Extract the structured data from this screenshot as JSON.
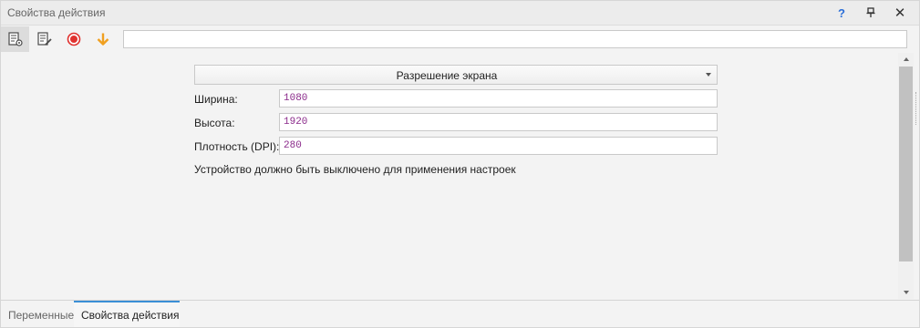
{
  "window": {
    "title": "Свойства действия",
    "help_glyph": "?",
    "close_glyph": "✕"
  },
  "toolbar": {
    "tools": [
      {
        "icon": "properties-list-icon",
        "active": true
      },
      {
        "icon": "edit-notes-icon",
        "active": false
      },
      {
        "icon": "record-icon",
        "color": "#e0322f",
        "active": false
      },
      {
        "icon": "arrow-down-icon",
        "color": "#f0a020",
        "active": false
      }
    ],
    "input_value": ""
  },
  "form": {
    "dropdown_value": "Разрешение экрана",
    "width_label": "Ширина:",
    "width_value": "1080",
    "height_label": "Высота:",
    "height_value": "1920",
    "dpi_label": "Плотность (DPI):",
    "dpi_value": "280",
    "note": "Устройство должно быть выключено для применения настроек"
  },
  "tabs": {
    "items": [
      {
        "label": "Переменные",
        "active": false
      },
      {
        "label": "Свойства действия",
        "active": true
      }
    ]
  },
  "colors": {
    "accent": "#3b8fd6",
    "value_text": "#8b2a8b",
    "help": "#2a6ed8"
  }
}
